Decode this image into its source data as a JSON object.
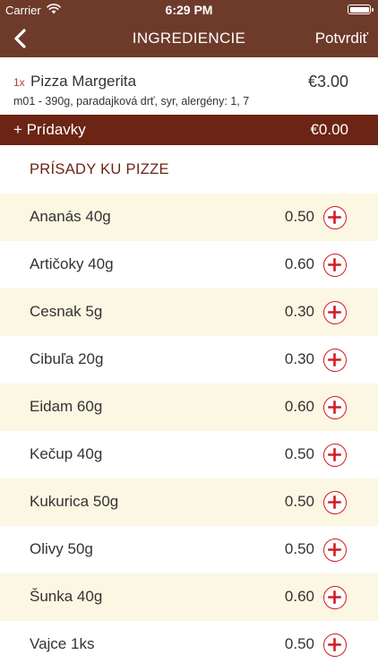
{
  "status_bar": {
    "carrier": "Carrier",
    "time": "6:29 PM"
  },
  "nav": {
    "title": "INGREDIENCIE",
    "confirm_label": "Potvrdiť"
  },
  "order": {
    "quantity": "1x",
    "name": "Pizza Margerita",
    "price": "€3.00",
    "description": "m01 - 390g, paradajková drť, syr, alergény: 1, 7"
  },
  "extras": {
    "label": "+ Prídavky",
    "total": "€0.00"
  },
  "section_title": "PRÍSADY KU PIZZE",
  "ingredients": [
    {
      "name": "Ananás 40g",
      "price": "0.50"
    },
    {
      "name": "Artičoky 40g",
      "price": "0.60"
    },
    {
      "name": "Cesnak 5g",
      "price": "0.30"
    },
    {
      "name": "Cibuľa 20g",
      "price": "0.30"
    },
    {
      "name": "Eidam 60g",
      "price": "0.60"
    },
    {
      "name": "Kečup 40g",
      "price": "0.50"
    },
    {
      "name": "Kukurica 50g",
      "price": "0.50"
    },
    {
      "name": "Olivy 50g",
      "price": "0.50"
    },
    {
      "name": "Šunka 40g",
      "price": "0.60"
    },
    {
      "name": "Vajce 1ks",
      "price": "0.50"
    }
  ],
  "icons": {
    "back": "chevron-left-icon",
    "add": "plus-circle-icon",
    "wifi": "wifi-icon",
    "battery": "battery-icon"
  },
  "colors": {
    "header": "#6e3b2b",
    "extras_bar": "#6c2414",
    "accent_red": "#d11c22",
    "row_alt": "#fbf7e3"
  }
}
